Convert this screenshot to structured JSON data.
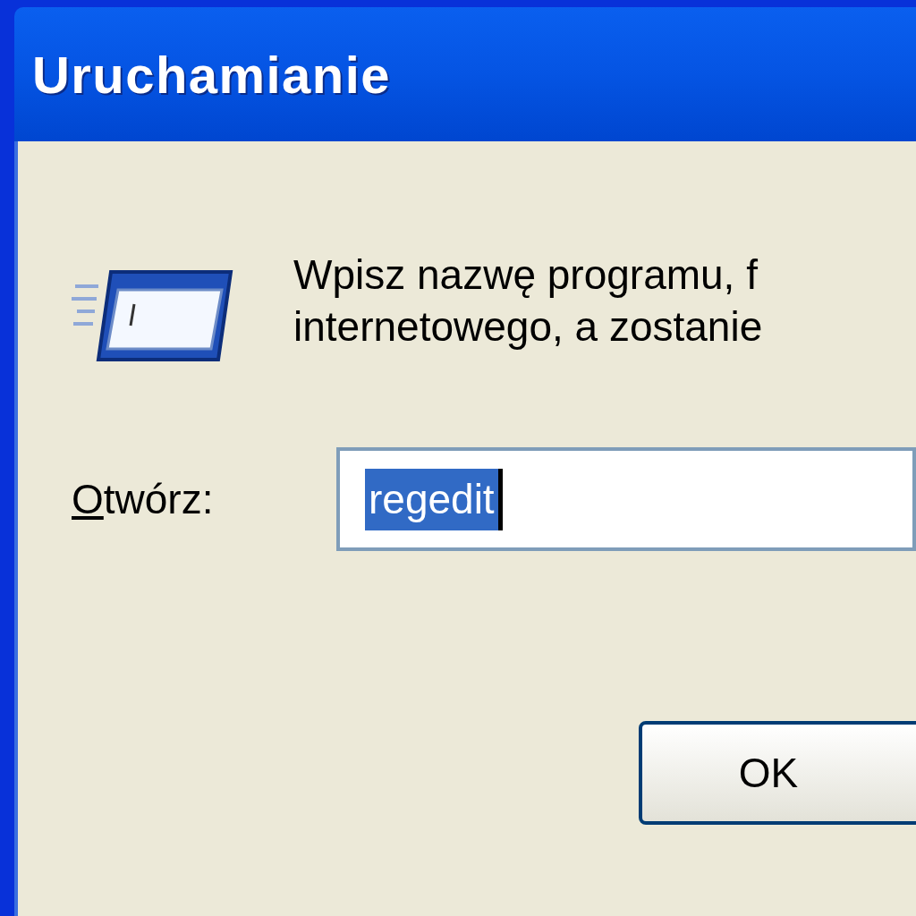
{
  "window": {
    "title": "Uruchamianie"
  },
  "description": {
    "lines": [
      "Wpisz nazwę programu, f",
      "internetowego, a zostanie"
    ]
  },
  "open_field": {
    "label": {
      "mnemonic": "O",
      "rest": "twórz:"
    },
    "value": "regedit",
    "text_selected": true
  },
  "buttons": [
    {
      "label": "OK"
    }
  ]
}
